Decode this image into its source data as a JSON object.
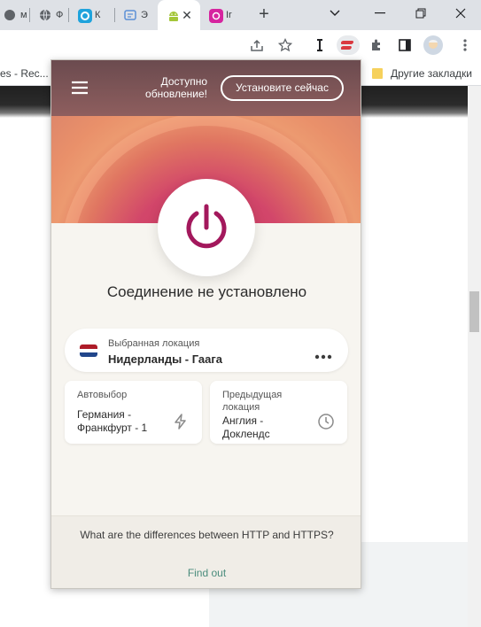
{
  "browser": {
    "tabs": [
      {
        "title": "м",
        "icon": "mail-icon"
      },
      {
        "title": "Ф",
        "icon": "globe-icon"
      },
      {
        "title": "К",
        "icon": "q-logo-icon"
      },
      {
        "title": "Э",
        "icon": "translate-icon"
      },
      {
        "title": "",
        "icon": "android-icon"
      },
      {
        "title": "Ir",
        "icon": "instagram-icon"
      }
    ],
    "close_glyph": "✕",
    "new_tab_glyph": "+",
    "bookmarks": {
      "left_item": "es - Rec...",
      "other_label": "Другие закладки"
    }
  },
  "popup": {
    "header": {
      "update_text": "Доступно обновление!",
      "install_button": "Установите сейчас"
    },
    "status": "Соединение не установлено",
    "selected_location": {
      "label": "Выбранная локация",
      "value": "Нидерланды - Гаага"
    },
    "smart_location": {
      "label": "Автовыбор",
      "value": "Германия - Франкфурт - 1"
    },
    "recent_location": {
      "label": "Предыдущая локация",
      "value": "Англия - Доклендс"
    },
    "footer": {
      "question": "What are the differences between HTTP and HTTPS?",
      "link": "Find out"
    }
  },
  "colors": {
    "accent": "#a3185c",
    "link": "#4a8c7c",
    "flag": [
      "#ae1c28",
      "#ffffff",
      "#21468b"
    ]
  }
}
